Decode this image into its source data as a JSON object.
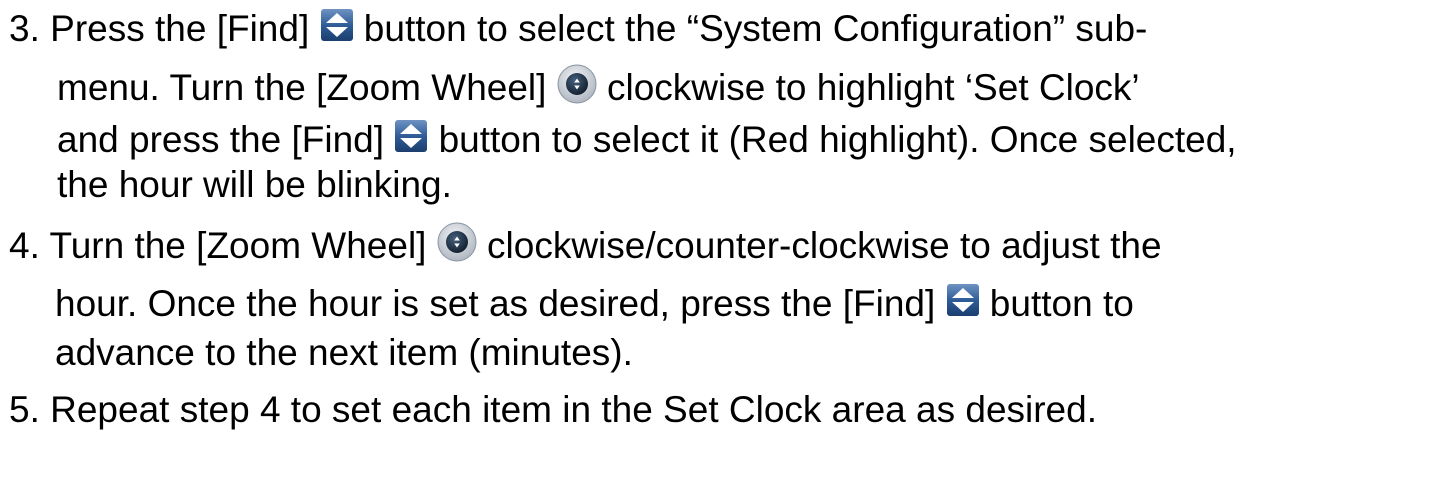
{
  "steps": [
    {
      "lines": [
        {
          "a": "3. Press the [Find] ",
          "b": " button to select the “System Configuration” sub-"
        },
        {
          "a": "menu. Turn the [Zoom Wheel] ",
          "b": " clockwise to highlight ‘Set Clock’"
        },
        {
          "a": "and press the [Find] ",
          "b": " button to select it (Red highlight). Once selected,"
        },
        {
          "a": "the hour will be blinking."
        }
      ]
    },
    {
      "lines": [
        {
          "a": "4. Turn the [Zoom Wheel] ",
          "b": " clockwise/counter-clockwise to adjust the"
        },
        {
          "a": "hour. Once the hour is set as desired, press the [Find] ",
          "b": " button to"
        },
        {
          "a": "advance to the next item (minutes)."
        }
      ]
    },
    {
      "lines": [
        {
          "a": "5. Repeat step 4 to set each item in the Set Clock area as desired."
        }
      ]
    }
  ],
  "icons": {
    "find": "find-button-icon",
    "zoom": "zoom-wheel-icon"
  },
  "colors": {
    "find_button_fill": "#2f5d98",
    "find_button_arrows": "#ffffff",
    "zoom_wheel_outer": "#d9dde3",
    "zoom_wheel_inner": "#243447"
  }
}
